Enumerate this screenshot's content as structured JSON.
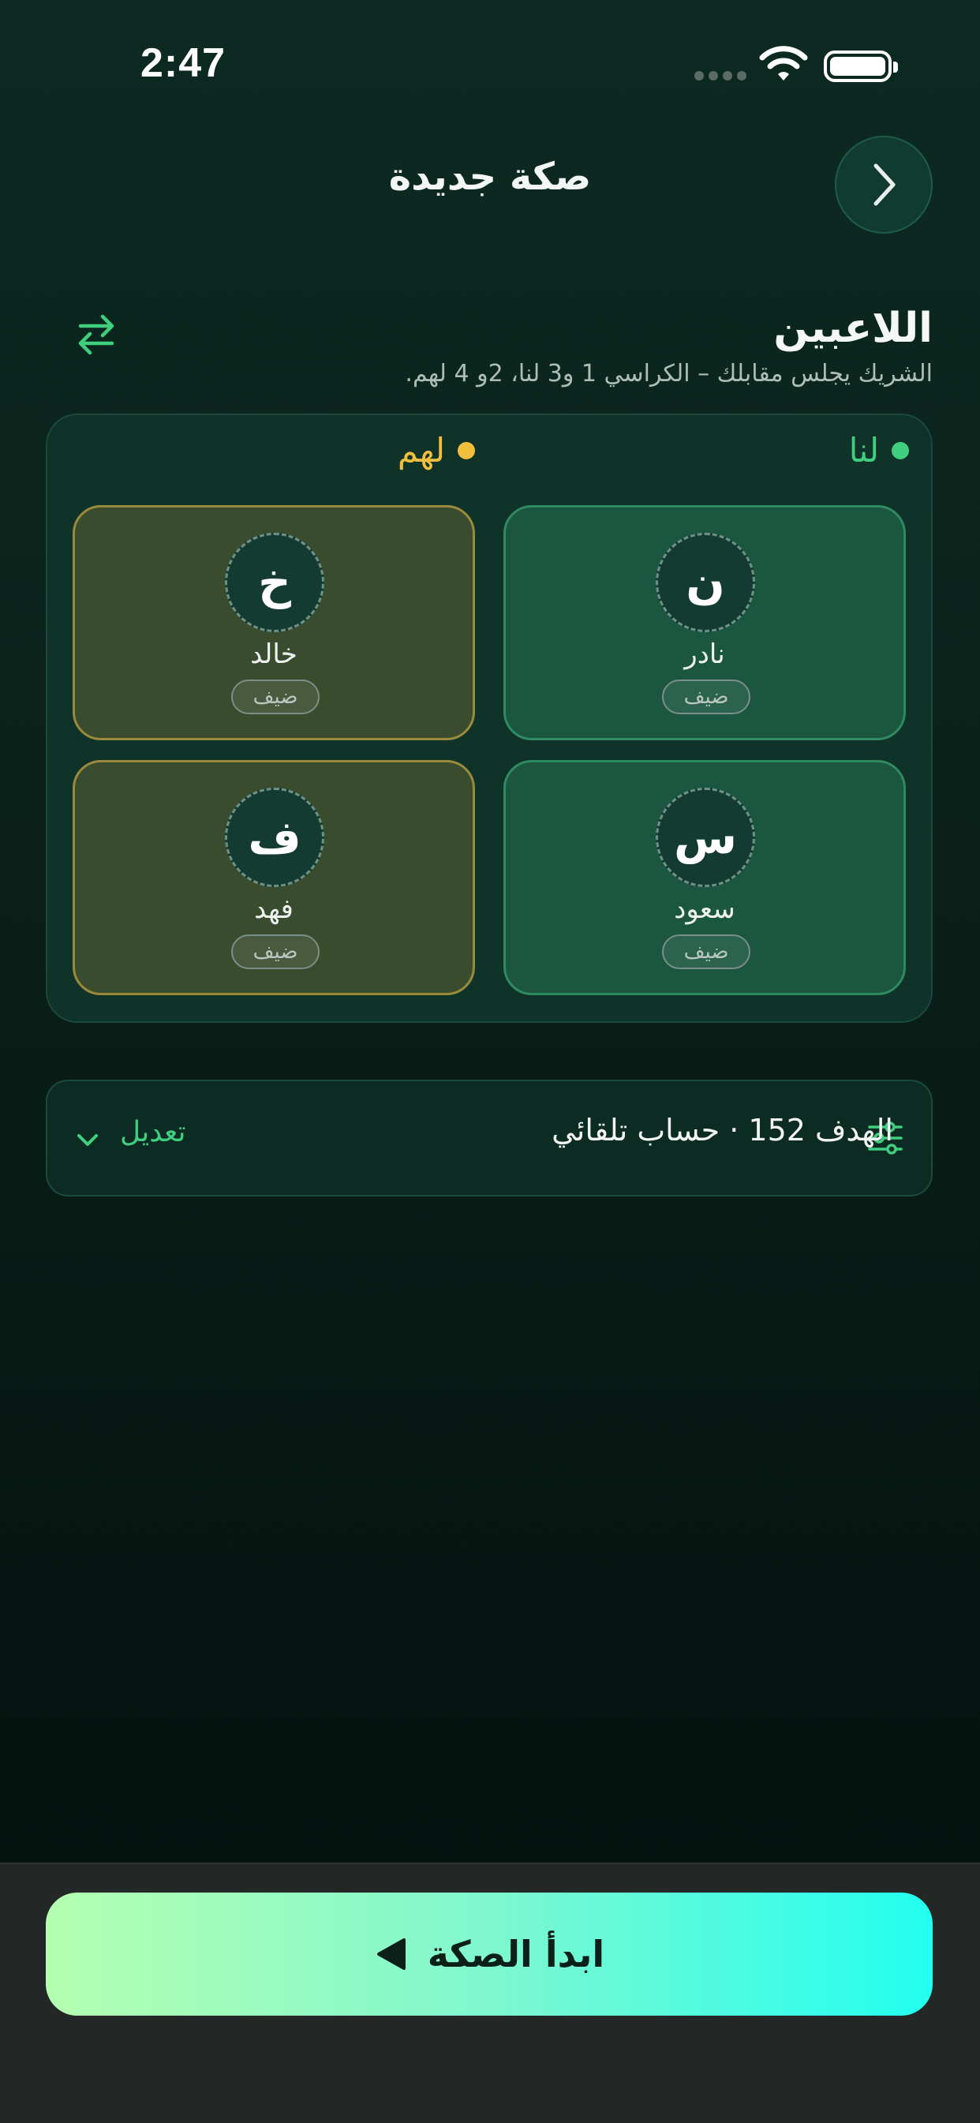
{
  "status_bar": {
    "time": "2:47"
  },
  "header": {
    "title": "صكة جديدة"
  },
  "players": {
    "title": "اللاعبين",
    "subtitle": "الشريك يجلس مقابلك – الكراسي 1 و3 لنا، 2و 4 لهم."
  },
  "teams": {
    "us": {
      "label": "لنا",
      "color": "#3fcf7f"
    },
    "them": {
      "label": "لهم",
      "color": "#f2bf3c"
    }
  },
  "seats": [
    {
      "initial": "ن",
      "name": "نادر",
      "badge": "ضيف",
      "team": "us"
    },
    {
      "initial": "خ",
      "name": "خالد",
      "badge": "ضيف",
      "team": "them"
    },
    {
      "initial": "س",
      "name": "سعود",
      "badge": "ضيف",
      "team": "us"
    },
    {
      "initial": "ف",
      "name": "فهد",
      "badge": "ضيف",
      "team": "them"
    }
  ],
  "settings": {
    "summary": "الهدف 152 · حساب تلقائي",
    "edit_label": "تعديل"
  },
  "cta": {
    "label": "ابدأ الصكة"
  },
  "icons": [
    "chevron-right-icon",
    "swap-icon",
    "sliders-icon",
    "chevron-down-icon",
    "play-icon",
    "wifi-icon",
    "battery-icon"
  ]
}
